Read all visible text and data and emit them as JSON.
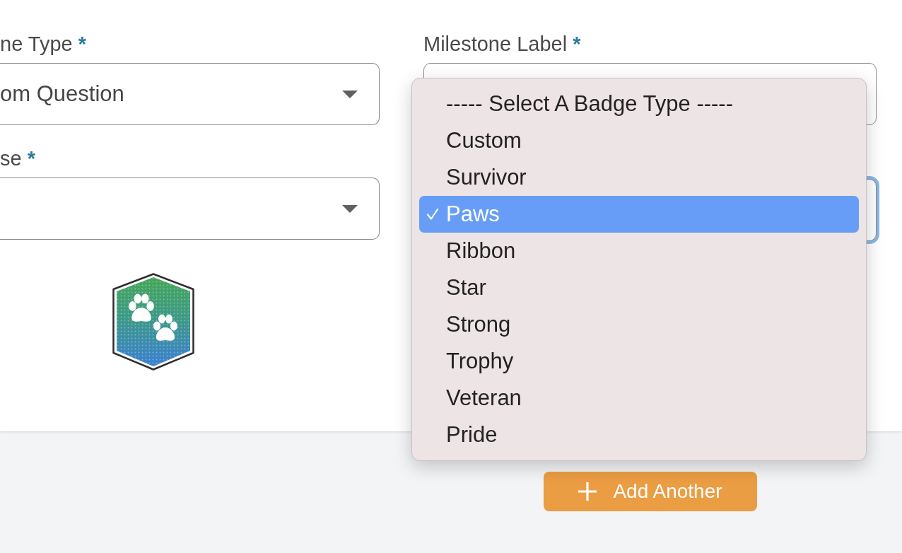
{
  "left_fields": [
    {
      "label": "ne Type",
      "required_mark": "*",
      "value": "om Question"
    },
    {
      "label": "se",
      "required_mark": "*"
    }
  ],
  "milestone_label": {
    "label": "Milestone Label",
    "required_mark": "*"
  },
  "badge_type_select": {
    "focused": true
  },
  "badge_type_menu": {
    "options": [
      {
        "label": "----- Select A Badge Type -----",
        "selected": false
      },
      {
        "label": "Custom",
        "selected": false
      },
      {
        "label": "Survivor",
        "selected": false
      },
      {
        "label": "Paws",
        "selected": true
      },
      {
        "label": "Ribbon",
        "selected": false
      },
      {
        "label": "Star",
        "selected": false
      },
      {
        "label": "Strong",
        "selected": false
      },
      {
        "label": "Trophy",
        "selected": false
      },
      {
        "label": "Veteran",
        "selected": false
      },
      {
        "label": "Pride",
        "selected": false
      }
    ]
  },
  "add_button": {
    "label": "Add Another"
  }
}
